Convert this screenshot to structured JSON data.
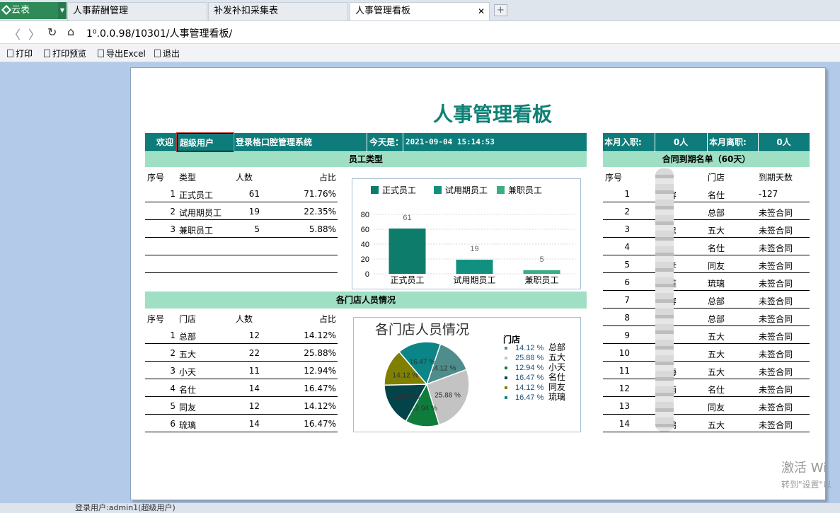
{
  "tabs": {
    "app": "云表",
    "items": [
      "人事薪酬管理",
      "补发补扣采集表",
      "人事管理看板"
    ]
  },
  "nav": {
    "url": "1⁰.0.0.98/10301/人事管理看板/"
  },
  "toolbar": {
    "print": "打印",
    "preview": "打印预览",
    "export": "导出Excel",
    "exit": "退出"
  },
  "title": "人事管理看板",
  "welcome": {
    "label": "欢迎",
    "user": "超级用户",
    "system": "登录格口腔管理系统",
    "today_label": "今天是：",
    "datetime": "2021-09-04  15:14:53"
  },
  "monthly": {
    "join_label": "本月入职:",
    "join_val": "0人",
    "leave_label": "本月离职:",
    "leave_val": "0人"
  },
  "emp_type": {
    "header": "员工类型",
    "cols": [
      "序号",
      "类型",
      "人数",
      "占比"
    ],
    "rows": [
      [
        "1",
        "正式员工",
        "61",
        "71.76%"
      ],
      [
        "2",
        "试用期员工",
        "19",
        "22.35%"
      ],
      [
        "3",
        "兼职员工",
        "5",
        "5.88%"
      ]
    ]
  },
  "stores": {
    "header": "各门店人员情况",
    "cols": [
      "序号",
      "门店",
      "人数",
      "占比"
    ],
    "rows": [
      [
        "1",
        "总部",
        "12",
        "14.12%"
      ],
      [
        "2",
        "五大",
        "22",
        "25.88%"
      ],
      [
        "3",
        "小天",
        "11",
        "12.94%"
      ],
      [
        "4",
        "名仕",
        "14",
        "16.47%"
      ],
      [
        "5",
        "同友",
        "12",
        "14.12%"
      ],
      [
        "6",
        "琉璃",
        "14",
        "16.47%"
      ]
    ]
  },
  "contracts": {
    "header": "合同到期名单（60天）",
    "cols": [
      "序号",
      "",
      "门店",
      "到期天数"
    ],
    "rows": [
      [
        "1",
        "容",
        "名仕",
        "-127"
      ],
      [
        "2",
        "",
        "总部",
        "未签合同"
      ],
      [
        "3",
        "忠",
        "五大",
        "未签合同"
      ],
      [
        "4",
        "",
        "名仕",
        "未签合同"
      ],
      [
        "5",
        "孝",
        "同友",
        "未签合同"
      ],
      [
        "6",
        "莲",
        "琉璃",
        "未签合同"
      ],
      [
        "7",
        "容",
        "总部",
        "未签合同"
      ],
      [
        "8",
        "",
        "总部",
        "未签合同"
      ],
      [
        "9",
        "",
        "五大",
        "未签合同"
      ],
      [
        "10",
        "",
        "五大",
        "未签合同"
      ],
      [
        "11",
        "海",
        "五大",
        "未签合同"
      ],
      [
        "12",
        "雨",
        "名仕",
        "未签合同"
      ],
      [
        "13",
        "",
        "同友",
        "未签合同"
      ],
      [
        "14",
        "鹏",
        "五大",
        "未签合同"
      ]
    ]
  },
  "chart_data": [
    {
      "type": "bar",
      "categories": [
        "正式员工",
        "试用期员工",
        "兼职员工"
      ],
      "values": [
        61,
        19,
        5
      ],
      "legend": [
        "正式员工",
        "试用期员工",
        "兼职员工"
      ],
      "ylim": [
        0,
        80
      ],
      "yticks": [
        0,
        20,
        40,
        60,
        80
      ],
      "colors": [
        "#0e7c6b",
        "#119080",
        "#3aad82"
      ],
      "legend_position": "top"
    },
    {
      "type": "pie",
      "title": "各门店人员情况",
      "legend_title": "门店",
      "categories": [
        "总部",
        "五大",
        "小天",
        "名仕",
        "同友",
        "琉璃"
      ],
      "values": [
        14.12,
        25.88,
        12.94,
        16.47,
        14.12,
        16.47
      ],
      "labels": [
        "14.12 %",
        "25.88 %",
        "12.94 %",
        "16.47 %",
        "14.12 %",
        "16.47 %"
      ],
      "colors": [
        "#4f8c8c",
        "#c3c3c3",
        "#0e7d3c",
        "#03434a",
        "#808000",
        "#0b8585"
      ],
      "legend_position": "right"
    }
  ],
  "status": "登录用户:admin1(超级用户)",
  "watermark": {
    "line1": "激活 Wi",
    "line2": "转到\"设置\"以"
  }
}
